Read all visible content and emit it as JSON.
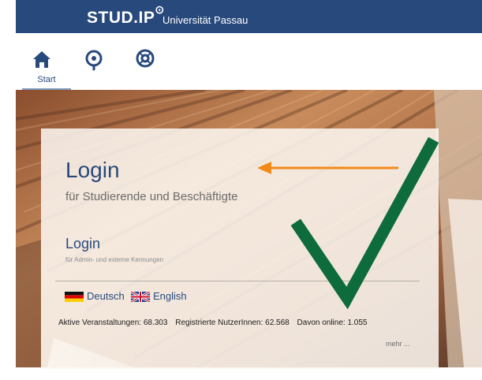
{
  "header": {
    "logo_text": "STUD.IP",
    "university": "Universität Passau"
  },
  "nav": {
    "start_label": "Start",
    "icons": [
      "home-icon",
      "studip-icon",
      "help-icon"
    ]
  },
  "login": {
    "title": "Login",
    "subtitle": "für Studierende und Beschäftigte",
    "secondary_title": "Login",
    "secondary_subtitle": "für Admin- und externe Kennungen"
  },
  "languages": {
    "german": "Deutsch",
    "english": "English"
  },
  "stats": {
    "active_courses": "Aktive Veranstaltungen: 68.303",
    "registered_users": "Registrierte NutzerInnen: 62.568",
    "online_users": "Davon online: 1.055"
  },
  "more": "mehr ...",
  "colors": {
    "header_blue": "#28497c",
    "accent_orange": "#f28a1a",
    "check_green": "#0d6b3c"
  }
}
